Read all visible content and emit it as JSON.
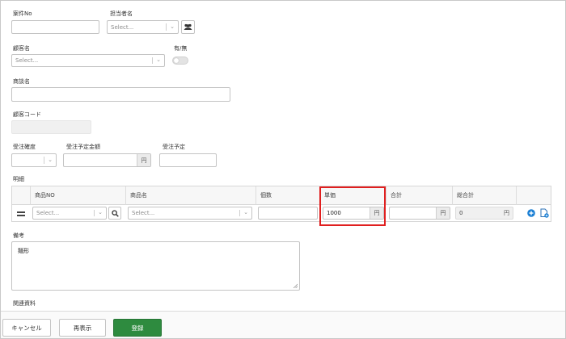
{
  "form": {
    "case_no_label": "案件No",
    "assignee_label": "担当者名",
    "assignee_placeholder": "Select...",
    "customer_label": "顧客名",
    "customer_placeholder": "Select...",
    "yes_no_label": "有/無",
    "deal_name_label": "商談名",
    "customer_code_label": "顧客コード",
    "order_prob_label": "受注確度",
    "order_amount_label": "受注予定金額",
    "order_amount_unit": "円",
    "order_date_label": "受注予定",
    "detail_label": "明細",
    "notes_label": "備考",
    "notes_value": "麺形",
    "attachments_label": "関連資料"
  },
  "table": {
    "headers": [
      "商品NO",
      "商品名",
      "個数",
      "単価",
      "合計",
      "総合計"
    ],
    "row": {
      "product_no_placeholder": "Select...",
      "product_name_placeholder": "Select...",
      "unit_price": "1000",
      "unit_price_unit": "円",
      "total_unit": "円",
      "grand_total": "0",
      "grand_total_unit": "円"
    }
  },
  "footer": {
    "cancel_label": "キャンセル",
    "redisplay_label": "再表示",
    "register_label": "登録"
  },
  "colors": {
    "primary": "#2e8b3f",
    "highlight": "#e01f1f",
    "add_icon": "#1a7fd4"
  }
}
